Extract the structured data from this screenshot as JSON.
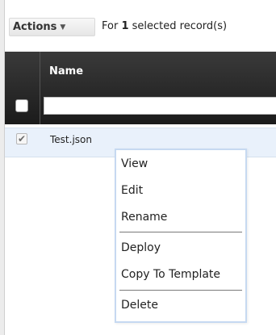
{
  "toolbar": {
    "actions_label": "Actions",
    "selection_prefix": "For",
    "selection_count": "1",
    "selection_suffix": "selected record(s)"
  },
  "grid": {
    "columns": [
      "Name"
    ],
    "filter_value": "",
    "rows": [
      {
        "name": "Test.json",
        "checked": true
      }
    ]
  },
  "context_menu": {
    "items": [
      "View",
      "Edit",
      "Rename",
      "Deploy",
      "Copy To Template",
      "Delete"
    ]
  }
}
